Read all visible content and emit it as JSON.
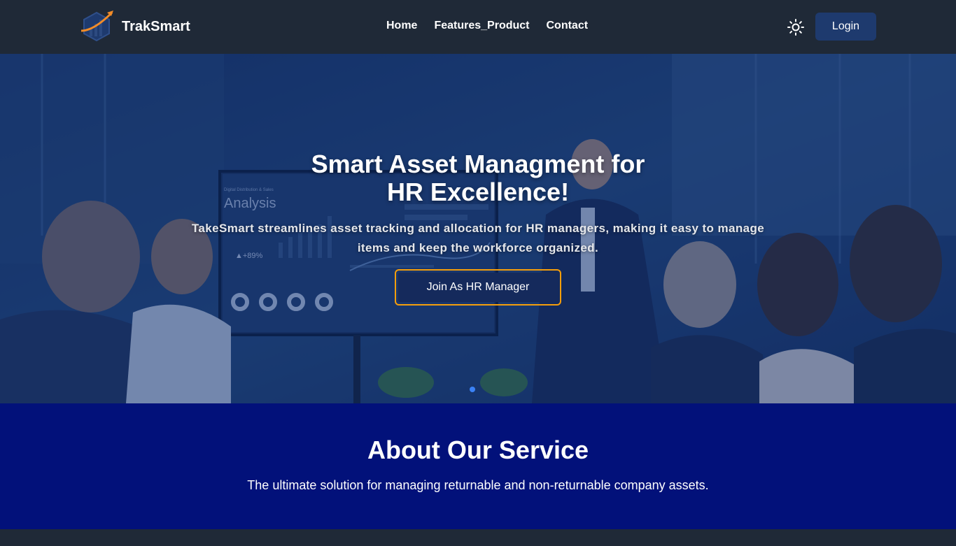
{
  "navbar": {
    "brand_name": "TrakSmart",
    "logo_icon": "rising-chart-logo-icon",
    "links": [
      {
        "label": "Home"
      },
      {
        "label": "Features_Product"
      },
      {
        "label": "Contact"
      }
    ],
    "theme_icon": "sun-icon",
    "login_label": "Login"
  },
  "hero": {
    "title_line1": "Smart Asset Managment for",
    "title_line2": "HR Excellence!",
    "subtitle": "TakeSmart streamlines asset tracking and allocation for HR managers, making it easy to manage items and keep the workforce organized.",
    "cta_label": "Join As HR Manager",
    "screen_heading": "Digital Distribution & Sales",
    "screen_title": "Analysis",
    "screen_metric": "▲+89%"
  },
  "about": {
    "title": "About Our Service",
    "text": "The ultimate solution for managing returnable and non-returnable company assets."
  },
  "colors": {
    "navbar_bg": "#1f2937",
    "login_bg": "#1e3a6e",
    "cta_border": "#f59e0b",
    "about_bg": "#02117a",
    "dot_active": "#3b82f6"
  }
}
